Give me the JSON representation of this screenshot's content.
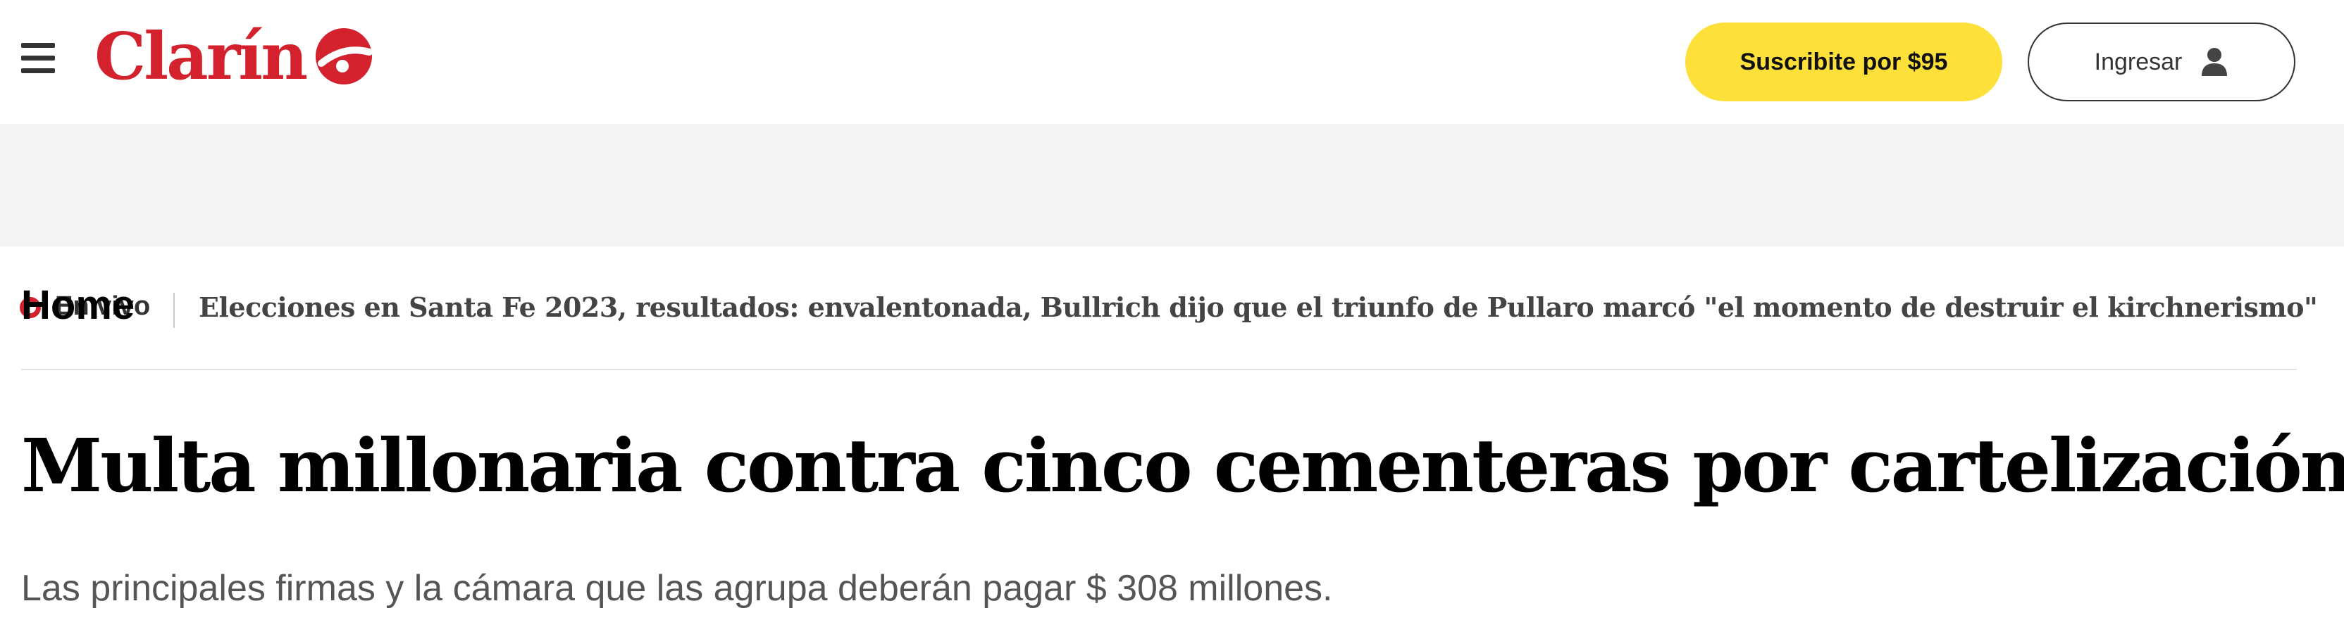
{
  "header": {
    "logo_text": "Clarín",
    "subscribe_label": "Suscribite por $95",
    "login_label": "Ingresar"
  },
  "live": {
    "label": "En vivo",
    "headline": "Elecciones en Santa Fe 2023, resultados: envalentonada, Bullrich dijo que el triunfo de Pullaro marcó \"el momento de destruir el kirchnerismo\""
  },
  "section": {
    "title": "Home"
  },
  "article": {
    "title": "Multa millonaria contra cinco cementeras por cartelización",
    "subtitle": "Las principales firmas y la cámara que las agrupa deberán pagar $ 308 millones."
  },
  "colors": {
    "brand": "#d3212d",
    "subscribe_bg": "#fde03a",
    "live_bar_bg": "#f4f4f4"
  },
  "icons": {
    "menu": "hamburger-menu-icon",
    "user": "user-icon",
    "live": "live-dot-icon"
  }
}
